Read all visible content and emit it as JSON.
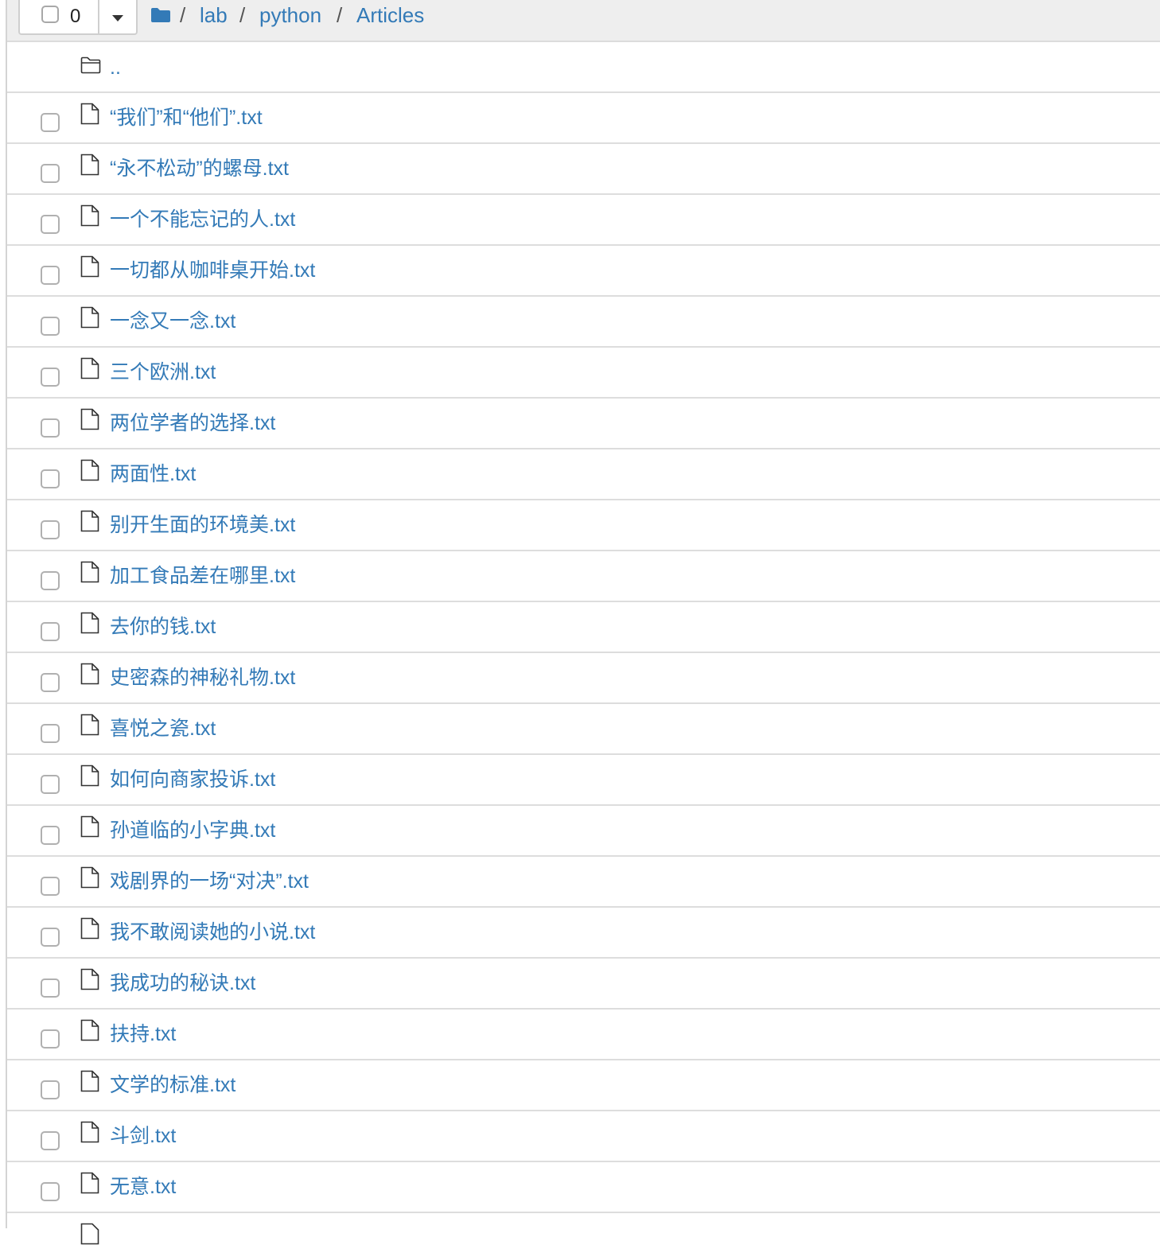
{
  "toolbar": {
    "selected_count": "0",
    "breadcrumb": [
      {
        "label": "lab"
      },
      {
        "label": "python"
      },
      {
        "label": "Articles"
      }
    ],
    "separator": "/"
  },
  "parent_dir": {
    "label": ".."
  },
  "files": [
    {
      "name": "“我们”和“他们”.txt"
    },
    {
      "name": "“永不松动”的螺母.txt"
    },
    {
      "name": "一个不能忘记的人.txt"
    },
    {
      "name": "一切都从咖啡桌开始.txt"
    },
    {
      "name": "一念又一念.txt"
    },
    {
      "name": "三个欧洲.txt"
    },
    {
      "name": "两位学者的选择.txt"
    },
    {
      "name": "两面性.txt"
    },
    {
      "name": "别开生面的环境美.txt"
    },
    {
      "name": "加工食品差在哪里.txt"
    },
    {
      "name": "去你的钱.txt"
    },
    {
      "name": "史密森的神秘礼物.txt"
    },
    {
      "name": "喜悦之瓷.txt"
    },
    {
      "name": "如何向商家投诉.txt"
    },
    {
      "name": "孙道临的小字典.txt"
    },
    {
      "name": "戏剧界的一场“对决”.txt"
    },
    {
      "name": "我不敢阅读她的小说.txt"
    },
    {
      "name": "我成功的秘诀.txt"
    },
    {
      "name": "扶持.txt"
    },
    {
      "name": "文学的标准.txt"
    },
    {
      "name": "斗剑.txt"
    },
    {
      "name": "无意.txt"
    }
  ],
  "icons": {
    "home": "folder-icon",
    "file": "file-icon",
    "parent": "folder-outline-icon"
  },
  "colors": {
    "link": "#337ab7",
    "header_bg": "#eeeeee",
    "border": "#dddddd"
  }
}
